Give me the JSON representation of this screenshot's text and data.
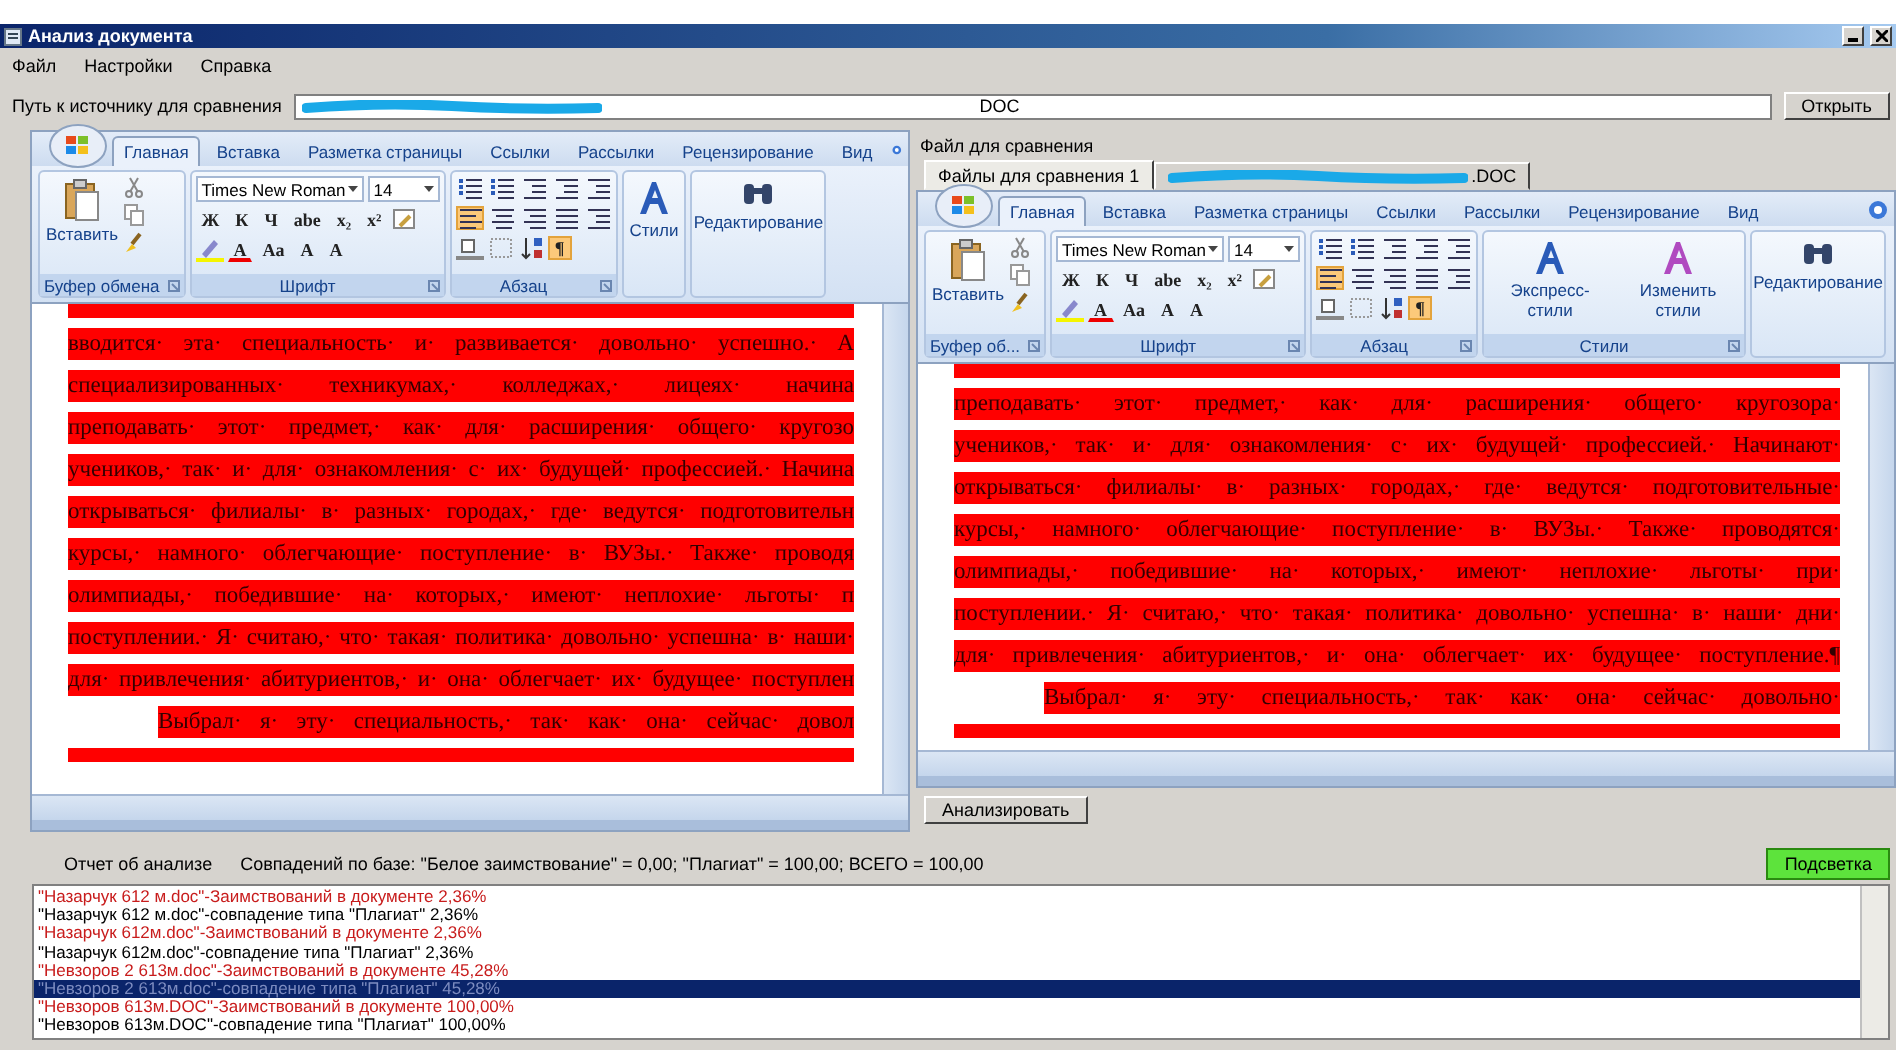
{
  "window": {
    "title": "Анализ документа"
  },
  "menu": [
    "Файл",
    "Настройки",
    "Справка"
  ],
  "source_path": {
    "label": "Путь к источнику для сравнения",
    "value": "DOC",
    "button": "Открыть"
  },
  "source_doc": {
    "ribbon": {
      "tabs": [
        {
          "label": "Главная",
          "selected": true
        },
        {
          "label": "Вставка",
          "selected": false
        },
        {
          "label": "Разметка страницы",
          "selected": false
        },
        {
          "label": "Ссылки",
          "selected": false
        },
        {
          "label": "Рассылки",
          "selected": false
        },
        {
          "label": "Рецензирование",
          "selected": false
        },
        {
          "label": "Вид",
          "selected": false
        }
      ],
      "clipboard": {
        "paste": "Вставить",
        "group": "Буфер обмена"
      },
      "font": {
        "name": "Times New Roman",
        "size": "14",
        "group": "Шрифт",
        "format_keys": [
          "Ж",
          "К",
          "Ч",
          "abe",
          "x₂",
          "x²"
        ],
        "color_key": "A",
        "case_keys": [
          "Aa",
          "A",
          "A"
        ]
      },
      "paragraph": {
        "group": "Абзац",
        "align_left_on": true,
        "marks_key": "¶",
        "marks_on": true
      },
      "styles": {
        "buttons": [
          "Стили"
        ]
      },
      "editing": "Редактирование"
    },
    "lines": [
      {
        "text": "вводится· эта· специальность· и· развивается· довольно· успешно.· А",
        "indent": false
      },
      {
        "text": "специализированных· техникумах,· колледжах,· лицеях· начина",
        "indent": false
      },
      {
        "text": "преподавать· этот· предмет,· как· для· расширения· общего· кругозо",
        "indent": false
      },
      {
        "text": "учеников,· так· и· для· ознакомления· с· их· будущей· профессией.· Начина",
        "indent": false
      },
      {
        "text": "открываться· филиалы· в· разных· городах,· где· ведутся· подготовительн",
        "indent": false
      },
      {
        "text": "курсы,· намного· облегчающие· поступление· в· ВУЗы.· Также· проводя",
        "indent": false
      },
      {
        "text": "олимпиады,· победившие· на· которых,· имеют· неплохие· льготы· п",
        "indent": false
      },
      {
        "text": "поступлении.· Я· считаю,· что· такая· политика· довольно· успешна· в· наши·",
        "indent": false
      },
      {
        "text": "для· привлечения· абитуриентов,· и· она· облегчает· их· будущее· поступлен",
        "indent": false
      },
      {
        "text": "Выбрал· я· эту· специальность,· так· как· она· сейчас· довол",
        "indent": true
      }
    ]
  },
  "compare": {
    "label": "Файл для сравнения",
    "tabs": [
      {
        "label": "Файлы для сравнения 1",
        "selected": true
      },
      {
        "label": ".DOC",
        "selected": false
      }
    ],
    "doc": {
      "ribbon": {
        "tabs": [
          {
            "label": "Главная",
            "selected": true
          },
          {
            "label": "Вставка",
            "selected": false
          },
          {
            "label": "Разметка страницы",
            "selected": false
          },
          {
            "label": "Ссылки",
            "selected": false
          },
          {
            "label": "Рассылки",
            "selected": false
          },
          {
            "label": "Рецензирование",
            "selected": false
          },
          {
            "label": "Вид",
            "selected": false
          }
        ],
        "clipboard": {
          "paste": "Вставить",
          "group": "Буфер об..."
        },
        "font": {
          "name": "Times New Roman",
          "size": "14",
          "group": "Шрифт",
          "format_keys": [
            "Ж",
            "К",
            "Ч",
            "abe",
            "x₂",
            "x²"
          ],
          "color_key": "A",
          "case_keys": [
            "Aa",
            "A",
            "A"
          ]
        },
        "paragraph": {
          "group": "Абзац",
          "align_left_on": true,
          "marks_key": "¶",
          "marks_on": true
        },
        "styles": {
          "buttons": [
            "Экспресс-стили",
            "Изменить стили"
          ],
          "group": "Стили"
        },
        "editing": "Редактирование"
      },
      "lines": [
        {
          "text": "преподавать· этот· предмет,· как· для· расширения· общего· кругозора·",
          "indent": false
        },
        {
          "text": "учеников,· так· и· для· ознакомления· с· их· будущей· профессией.· Начинают·",
          "indent": false
        },
        {
          "text": "открываться· филиалы· в· разных· городах,· где· ведутся· подготовительные·",
          "indent": false
        },
        {
          "text": "курсы,· намного· облегчающие· поступление· в· ВУЗы.· Также· проводятся·",
          "indent": false
        },
        {
          "text": "олимпиады,· победившие· на· которых,· имеют· неплохие· льготы· при·",
          "indent": false
        },
        {
          "text": "поступлении.· Я· считаю,· что· такая· политика· довольно· успешна· в· наши· дни·",
          "indent": false
        },
        {
          "text": "для· привлечения· абитуриентов,· и· она· облегчает· их· будущее· поступление.¶",
          "indent": false
        },
        {
          "text": "Выбрал· я· эту· специальность,· так· как· она· сейчас· довольно·",
          "indent": true
        }
      ]
    },
    "button": "Анализировать"
  },
  "report": {
    "label": "Отчет об анализе",
    "summary": "Совпадений по базе: \"Белое заимствование\" = 0,00; \"Плагиат\"  = 100,00; ВСЕГО = 100,00",
    "button": "Подсветка",
    "items": [
      {
        "text": "\"Назарчук 612 м.doc\"-Заимствований в документе 2,36%",
        "kind": "borrowed",
        "selected": false
      },
      {
        "text": "\"Назарчук 612 м.doc\"-совпадение типа \"Плагиат\" 2,36%",
        "kind": "match",
        "selected": false
      },
      {
        "text": "\"Назарчук 612м.doc\"-Заимствований в документе 2,36%",
        "kind": "borrowed",
        "selected": false
      },
      {
        "text": "\"Назарчук 612м.doc\"-совпадение типа \"Плагиат\" 2,36%",
        "kind": "match",
        "selected": false
      },
      {
        "text": "\"Невзоров 2 613м.doc\"-Заимствований в документе 45,28%",
        "kind": "borrowed",
        "selected": false
      },
      {
        "text": "\"Невзоров 2 613м.doc\"-совпадение типа \"Плагиат\" 45,28%",
        "kind": "match",
        "selected": true
      },
      {
        "text": "\"Невзоров 613м.DOC\"-Заимствований в документе 100,00%",
        "kind": "borrowed",
        "selected": false
      },
      {
        "text": "\"Невзоров 613м.DOC\"-совпадение типа \"Плагиат\" 100,00%",
        "kind": "match",
        "selected": false
      }
    ]
  }
}
